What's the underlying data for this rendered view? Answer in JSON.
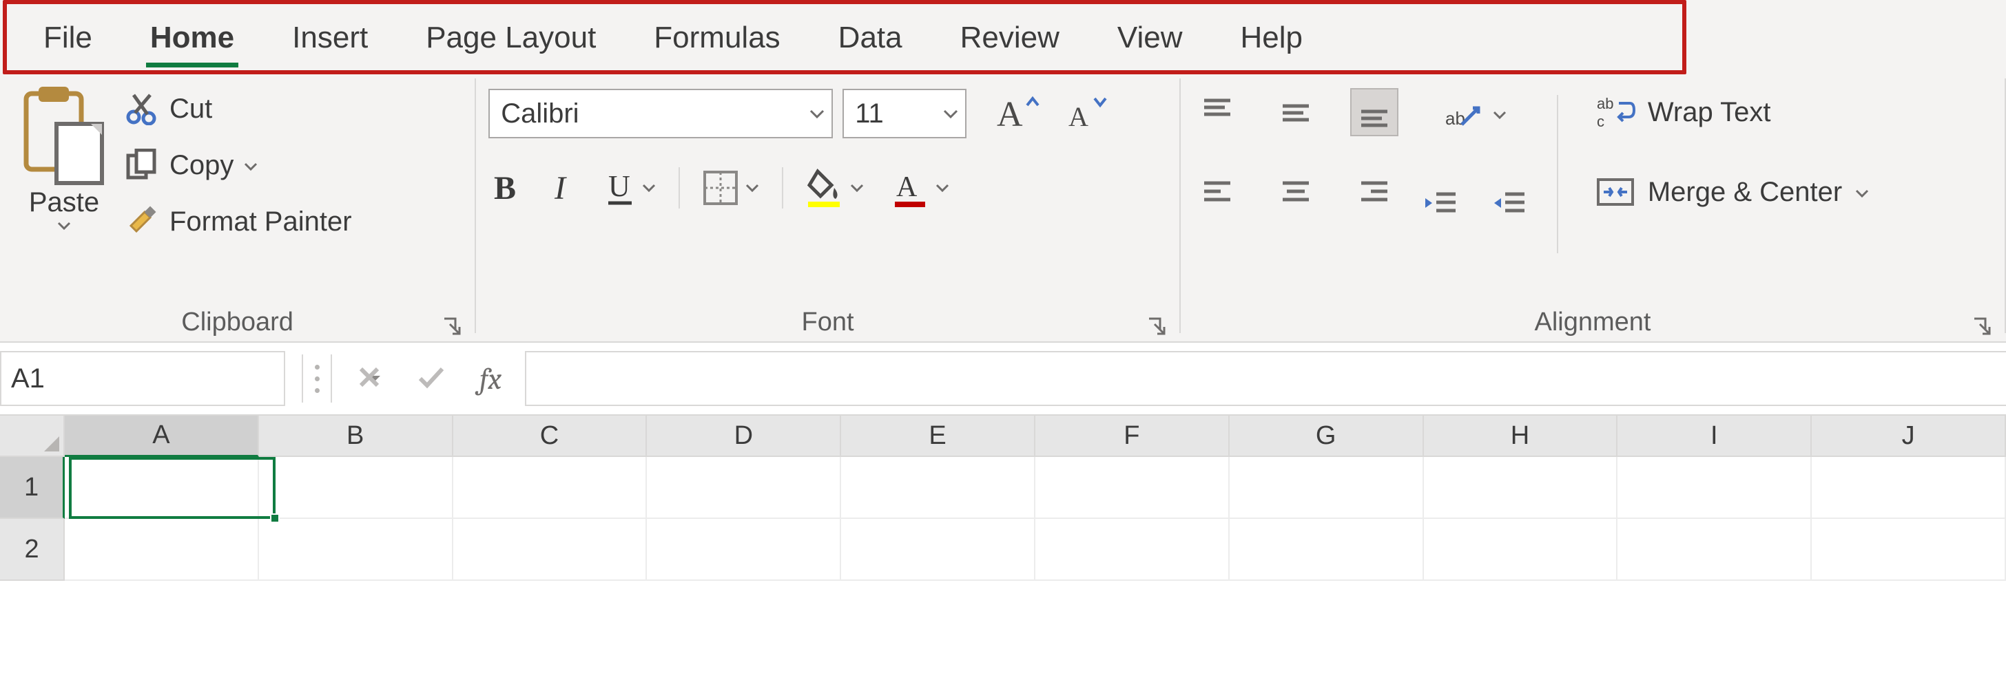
{
  "tabs": {
    "file": "File",
    "home": "Home",
    "insert": "Insert",
    "page_layout": "Page Layout",
    "formulas": "Formulas",
    "data": "Data",
    "review": "Review",
    "view": "View",
    "help": "Help",
    "active": "home"
  },
  "ribbon": {
    "clipboard": {
      "paste": "Paste",
      "cut": "Cut",
      "copy": "Copy",
      "format_painter": "Format Painter",
      "group_label": "Clipboard"
    },
    "font": {
      "name": "Calibri",
      "size": "11",
      "group_label": "Font"
    },
    "alignment": {
      "wrap_text": "Wrap Text",
      "merge_center": "Merge & Center",
      "group_label": "Alignment"
    }
  },
  "namebar": {
    "cell_ref": "A1",
    "formula": "",
    "fx_label": "fx"
  },
  "sheet": {
    "columns": [
      "A",
      "B",
      "C",
      "D",
      "E",
      "F",
      "G",
      "H",
      "I",
      "J"
    ],
    "rows": [
      "1",
      "2"
    ],
    "selected_cell": "A1"
  },
  "colors": {
    "accent_green": "#107c41",
    "fill_yellow": "#ffff00",
    "font_red": "#c00000"
  }
}
